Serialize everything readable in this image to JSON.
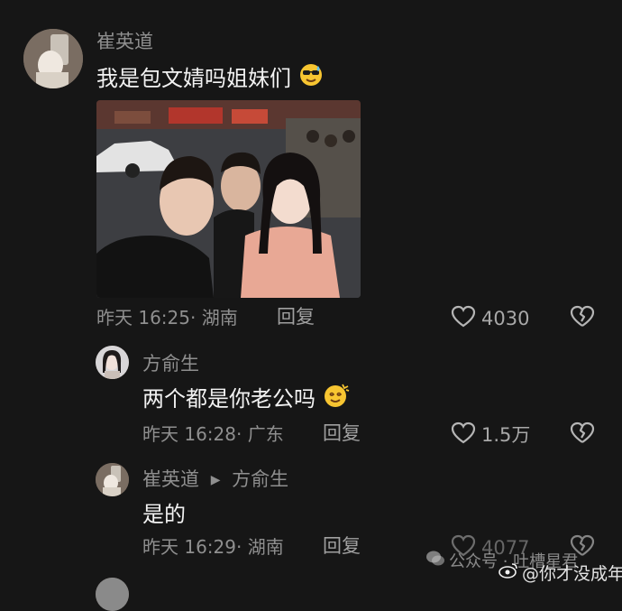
{
  "comments": [
    {
      "username": "崔英道",
      "text": "我是包文婧吗姐妹们",
      "emoji": "sunglasses-sweat-emoji",
      "time": "昨天 16:25",
      "location": "· 湖南",
      "reply_label": "回复",
      "likes": "4030"
    },
    {
      "username": "方俞生",
      "text": "两个都是你老公吗",
      "emoji": "dizzy-smile-emoji",
      "time": "昨天 16:28",
      "location": "· 广东",
      "reply_label": "回复",
      "likes": "1.5万"
    },
    {
      "username": "崔英道",
      "reply_to": "方俞生",
      "text": "是的",
      "time": "昨天 16:29",
      "location": "· 湖南",
      "reply_label": "回复",
      "likes": "4077"
    }
  ],
  "watermark": {
    "text1": "公众号 · 吐槽星君",
    "text2": "@你才没成年"
  },
  "colors": {
    "background": "#161616",
    "username": "#8f8f8f",
    "text": "#f2f2f2"
  }
}
